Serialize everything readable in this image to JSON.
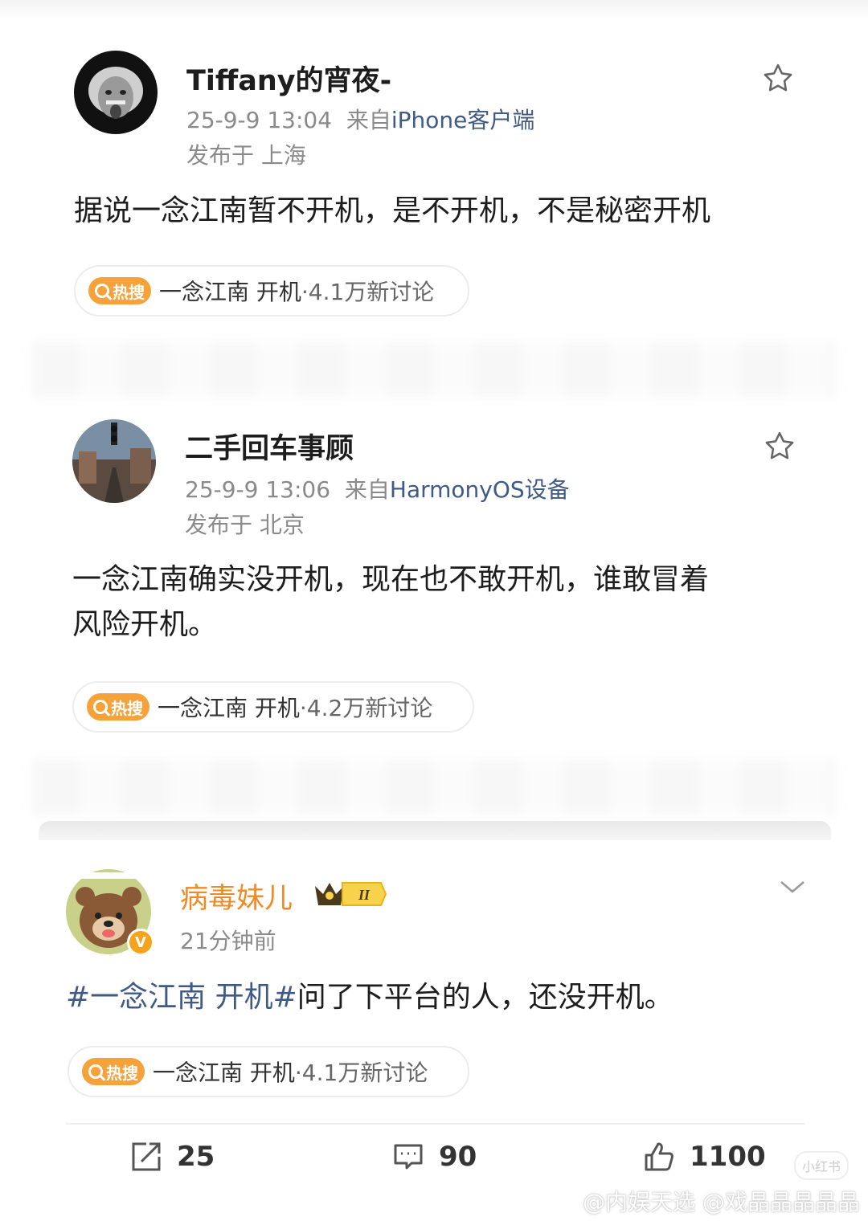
{
  "posts": [
    {
      "username": "Tiffany的宵夜-",
      "time": "25-9-9 13:04",
      "from_prefix": "来自",
      "source": "iPhone客户端",
      "location": "发布于 上海",
      "text": "据说一念江南暂不开机，是不开机，不是秘密开机",
      "hot": {
        "badge": "热搜",
        "topic": "一念江南 开机",
        "count": "·4.1万新讨论"
      }
    },
    {
      "username": "二手回车事顾",
      "time": "25-9-9 13:06",
      "from_prefix": "来自",
      "source": "HarmonyOS设备",
      "location": "发布于 北京",
      "text_line1": "一念江南确实没开机，现在也不敢开机，谁敢冒着",
      "text_line2": "风险开机。",
      "hot": {
        "badge": "热搜",
        "topic": "一念江南 开机",
        "count": "·4.2万新讨论"
      }
    },
    {
      "username": "病毒妹儿",
      "time": "21分钟前",
      "vip_level": "II",
      "hashtag": "#一念江南 开机#",
      "text": "问了下平台的人，还没开机。",
      "hot": {
        "badge": "热搜",
        "topic": "一念江南 开机",
        "count": "·4.1万新讨论"
      }
    }
  ],
  "actions": {
    "repost": "25",
    "comment": "90",
    "like": "1100"
  },
  "watermark": {
    "text": "@内娱天选     @戏晶晶晶晶晶",
    "corner_tag": "小红书"
  },
  "colors": {
    "link": "#3f5a86",
    "orange": "#f08a24",
    "hot_badge": "#f6a23a"
  }
}
